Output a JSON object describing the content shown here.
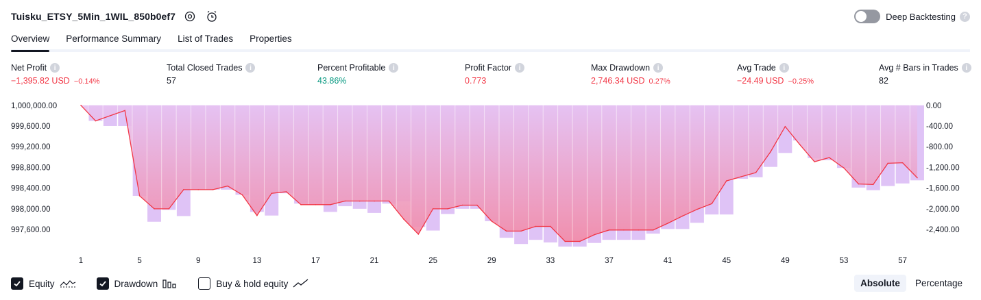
{
  "header": {
    "strategy_name": "Tuisku_ETSY_5Min_1WIL_850b0ef7",
    "settings_icon": "gear-icon",
    "alert_icon": "alarm-clock-plus-icon",
    "deep_backtesting_label": "Deep Backtesting",
    "deep_backtesting_enabled": false,
    "help_icon_text": "?"
  },
  "tabs": [
    {
      "label": "Overview",
      "active": true
    },
    {
      "label": "Performance Summary",
      "active": false
    },
    {
      "label": "List of Trades",
      "active": false
    },
    {
      "label": "Properties",
      "active": false
    }
  ],
  "metrics": [
    {
      "label": "Net Profit",
      "value": "−1,395.82 USD",
      "pct": "−0.14%",
      "tone": "neg"
    },
    {
      "label": "Total Closed Trades",
      "value": "57",
      "pct": "",
      "tone": "neutral"
    },
    {
      "label": "Percent Profitable",
      "value": "43.86%",
      "pct": "",
      "tone": "pos"
    },
    {
      "label": "Profit Factor",
      "value": "0.773",
      "pct": "",
      "tone": "neg"
    },
    {
      "label": "Max Drawdown",
      "value": "2,746.34 USD",
      "pct": "0.27%",
      "tone": "neg"
    },
    {
      "label": "Avg Trade",
      "value": "−24.49 USD",
      "pct": "−0.25%",
      "tone": "neg"
    },
    {
      "label": "Avg # Bars in Trades",
      "value": "82",
      "pct": "",
      "tone": "neutral"
    }
  ],
  "info_icon_text": "i",
  "chart_data": {
    "type": "line",
    "x": [
      1,
      2,
      3,
      4,
      5,
      6,
      7,
      8,
      9,
      10,
      11,
      12,
      13,
      14,
      15,
      16,
      17,
      18,
      19,
      20,
      21,
      22,
      23,
      24,
      25,
      26,
      27,
      28,
      29,
      30,
      31,
      32,
      33,
      34,
      35,
      36,
      37,
      38,
      39,
      40,
      41,
      42,
      43,
      44,
      45,
      46,
      47,
      48,
      49,
      50,
      51,
      52,
      53,
      54,
      55,
      56,
      57,
      58
    ],
    "x_tick_labels": [
      "1",
      "5",
      "9",
      "13",
      "17",
      "21",
      "25",
      "29",
      "33",
      "37",
      "41",
      "45",
      "49",
      "53",
      "57"
    ],
    "y_left_ticks": [
      "1,000,000.00",
      "999,600.00",
      "999,200.00",
      "998,800.00",
      "998,400.00",
      "998,000.00",
      "997,600.00"
    ],
    "y_right_ticks": [
      "0.00",
      "-400.00",
      "-800.00",
      "-1,200.00",
      "-1,600.00",
      "-2,000.00",
      "-2,400.00"
    ],
    "ylim_left": [
      997270,
      1000050
    ],
    "ylim_right": [
      -2730,
      50
    ],
    "series": [
      {
        "name": "Equity",
        "color": "#f23645",
        "values": [
          1000000,
          999700,
          999800,
          999900,
          998250,
          998000,
          998000,
          998370,
          998370,
          998370,
          998440,
          998270,
          997870,
          998300,
          998330,
          998080,
          998080,
          998080,
          998150,
          998150,
          998150,
          998150,
          997800,
          997510,
          998000,
          998000,
          998070,
          998070,
          997760,
          997570,
          997570,
          997660,
          997660,
          997370,
          997370,
          997500,
          997590,
          997590,
          997590,
          997590,
          997720,
          997860,
          997990,
          998100,
          998540,
          998620,
          998700,
          999100,
          999590,
          999240,
          998910,
          998990,
          998790,
          998480,
          998470,
          998880,
          998890,
          998600
        ]
      },
      {
        "name": "Drawdown",
        "color": "#d9b8f5",
        "values": [
          0,
          -300,
          -400,
          -400,
          -1750,
          -2250,
          -2020,
          -2140,
          -1630,
          -1630,
          -1630,
          -1730,
          -2060,
          -2130,
          -1700,
          -1900,
          -1920,
          -2060,
          -1950,
          -2000,
          -2080,
          -1900,
          -1850,
          -2350,
          -2420,
          -2100,
          -2000,
          -2000,
          -2240,
          -2560,
          -2680,
          -2600,
          -2650,
          -2730,
          -2730,
          -2660,
          -2600,
          -2600,
          -2600,
          -2480,
          -2390,
          -2390,
          -2270,
          -2110,
          -2110,
          -1420,
          -1390,
          -1190,
          -920,
          -680,
          -1020,
          -1060,
          -1210,
          -1590,
          -1640,
          -1560,
          -1510,
          -1450
        ]
      },
      {
        "name": "Buy & hold equity",
        "values": []
      }
    ],
    "grid": false,
    "legend_position": "bottom-left"
  },
  "legend": [
    {
      "label": "Equity",
      "checked": true,
      "glyph": "equity-line-icon"
    },
    {
      "label": "Drawdown",
      "checked": true,
      "glyph": "drawdown-bars-icon"
    },
    {
      "label": "Buy & hold equity",
      "checked": false,
      "glyph": "buy-hold-line-icon"
    }
  ],
  "modes": [
    {
      "label": "Absolute",
      "active": true
    },
    {
      "label": "Percentage",
      "active": false
    }
  ]
}
